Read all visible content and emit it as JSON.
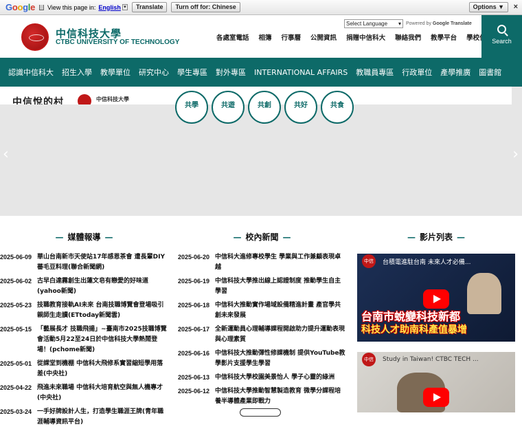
{
  "translate_bar": {
    "brand": "Google",
    "prompt": "View this page in:",
    "language": "English",
    "translate_btn": "Translate",
    "turnoff_btn": "Turn off for: Chinese",
    "options_btn": "Options ▼",
    "close": "×"
  },
  "header": {
    "school_zh": "中信科技大學",
    "school_en": "CTBC UNIVERSITY OF TECHNOLOGY",
    "lang_select": "Select Language",
    "powered_prefix": "Powered by",
    "powered_brand": "Google",
    "powered_suffix": "Translate",
    "links": [
      "各處室電話",
      "相簿",
      "行事曆",
      "公開資訊",
      "捐贈中信科大",
      "聯絡我們",
      "教學平台",
      "學校位置"
    ],
    "search_label": "Search"
  },
  "nav": [
    "認識中信科大",
    "招生入學",
    "教學單位",
    "研究中心",
    "學生專區",
    "對外專區",
    "INTERNATIONAL AFFAIRS",
    "教職員專區",
    "行政單位",
    "產學推廣",
    "圖書館"
  ],
  "banner": {
    "script_text": "中信悅的村",
    "school_name": "中信科技大學",
    "bubbles": [
      "共學",
      "共遊",
      "共創",
      "共好",
      "共食"
    ],
    "prev": "‹",
    "next": "›"
  },
  "columns": {
    "media": {
      "title": "媒體報導",
      "items": [
        {
          "date": "2025-06-09",
          "text": "華山台南新市天使站17年感恩茶會 遭長輩DIY蕃毛豆料理(聯合新聞網)"
        },
        {
          "date": "2025-06-02",
          "text": "古早白達霧創生出蓮文皂有戀愛的好味道(yahoo新聞)"
        },
        {
          "date": "2025-05-23",
          "text": "技職教育接軌AI未來 台南技職博覽會登場吸引親師生走讀(ETtoday新聞雲)"
        },
        {
          "date": "2025-05-15",
          "text": "「藝展長才 技職飛揚」~臺南市2025技職博覽會活動5月22至24日於中信科技大學熱鬧登場！(pchome新聞)"
        },
        {
          "date": "2025-05-01",
          "text": "從課堂到機棚 中信科大飛修系實習縮短學用落差(中央社)"
        },
        {
          "date": "2025-04-22",
          "text": "飛進未來職場 中信科大培育航空與無人機專才(中央社)"
        },
        {
          "date": "2025-03-24",
          "text": "一手好牌設計人生，打造學生職涯王牌(青年職涯輔導資訊平台)"
        }
      ]
    },
    "campus": {
      "title": "校內新聞",
      "items": [
        {
          "date": "2025-06-20",
          "text": "中信科大進修專校學生 學業與工作兼顧表現卓越"
        },
        {
          "date": "2025-06-19",
          "text": "中信科技大學推出線上認證制度 推動學生自主學習"
        },
        {
          "date": "2025-06-18",
          "text": "中信科大推動實作場域設備精進計畫 產官學共創未來發展"
        },
        {
          "date": "2025-06-17",
          "text": "全新運動員心理輔導課程開啟助力提升運動表現與心理素質"
        },
        {
          "date": "2025-06-16",
          "text": "中信科技大推動彈性修課機制 提供YouTube教學影片支援學生學習"
        },
        {
          "date": "2025-06-13",
          "text": "中信科技大學校園美景怡人 學子心靈的綠洲"
        },
        {
          "date": "2025-06-12",
          "text": "中信科技大學推動智慧製造教育 微學分課程培養半導體產業即戰力"
        }
      ]
    },
    "video": {
      "title": "影片列表",
      "videos": [
        {
          "channel": "中信",
          "title": "台積電進駐台南 未來人才必備...",
          "caption1": "台南市蛻變科技新都",
          "caption2": "科技人才助南科產值暴增"
        },
        {
          "channel": "中信",
          "title": "Study in Taiwan! CTBC TECH ..."
        }
      ]
    }
  }
}
